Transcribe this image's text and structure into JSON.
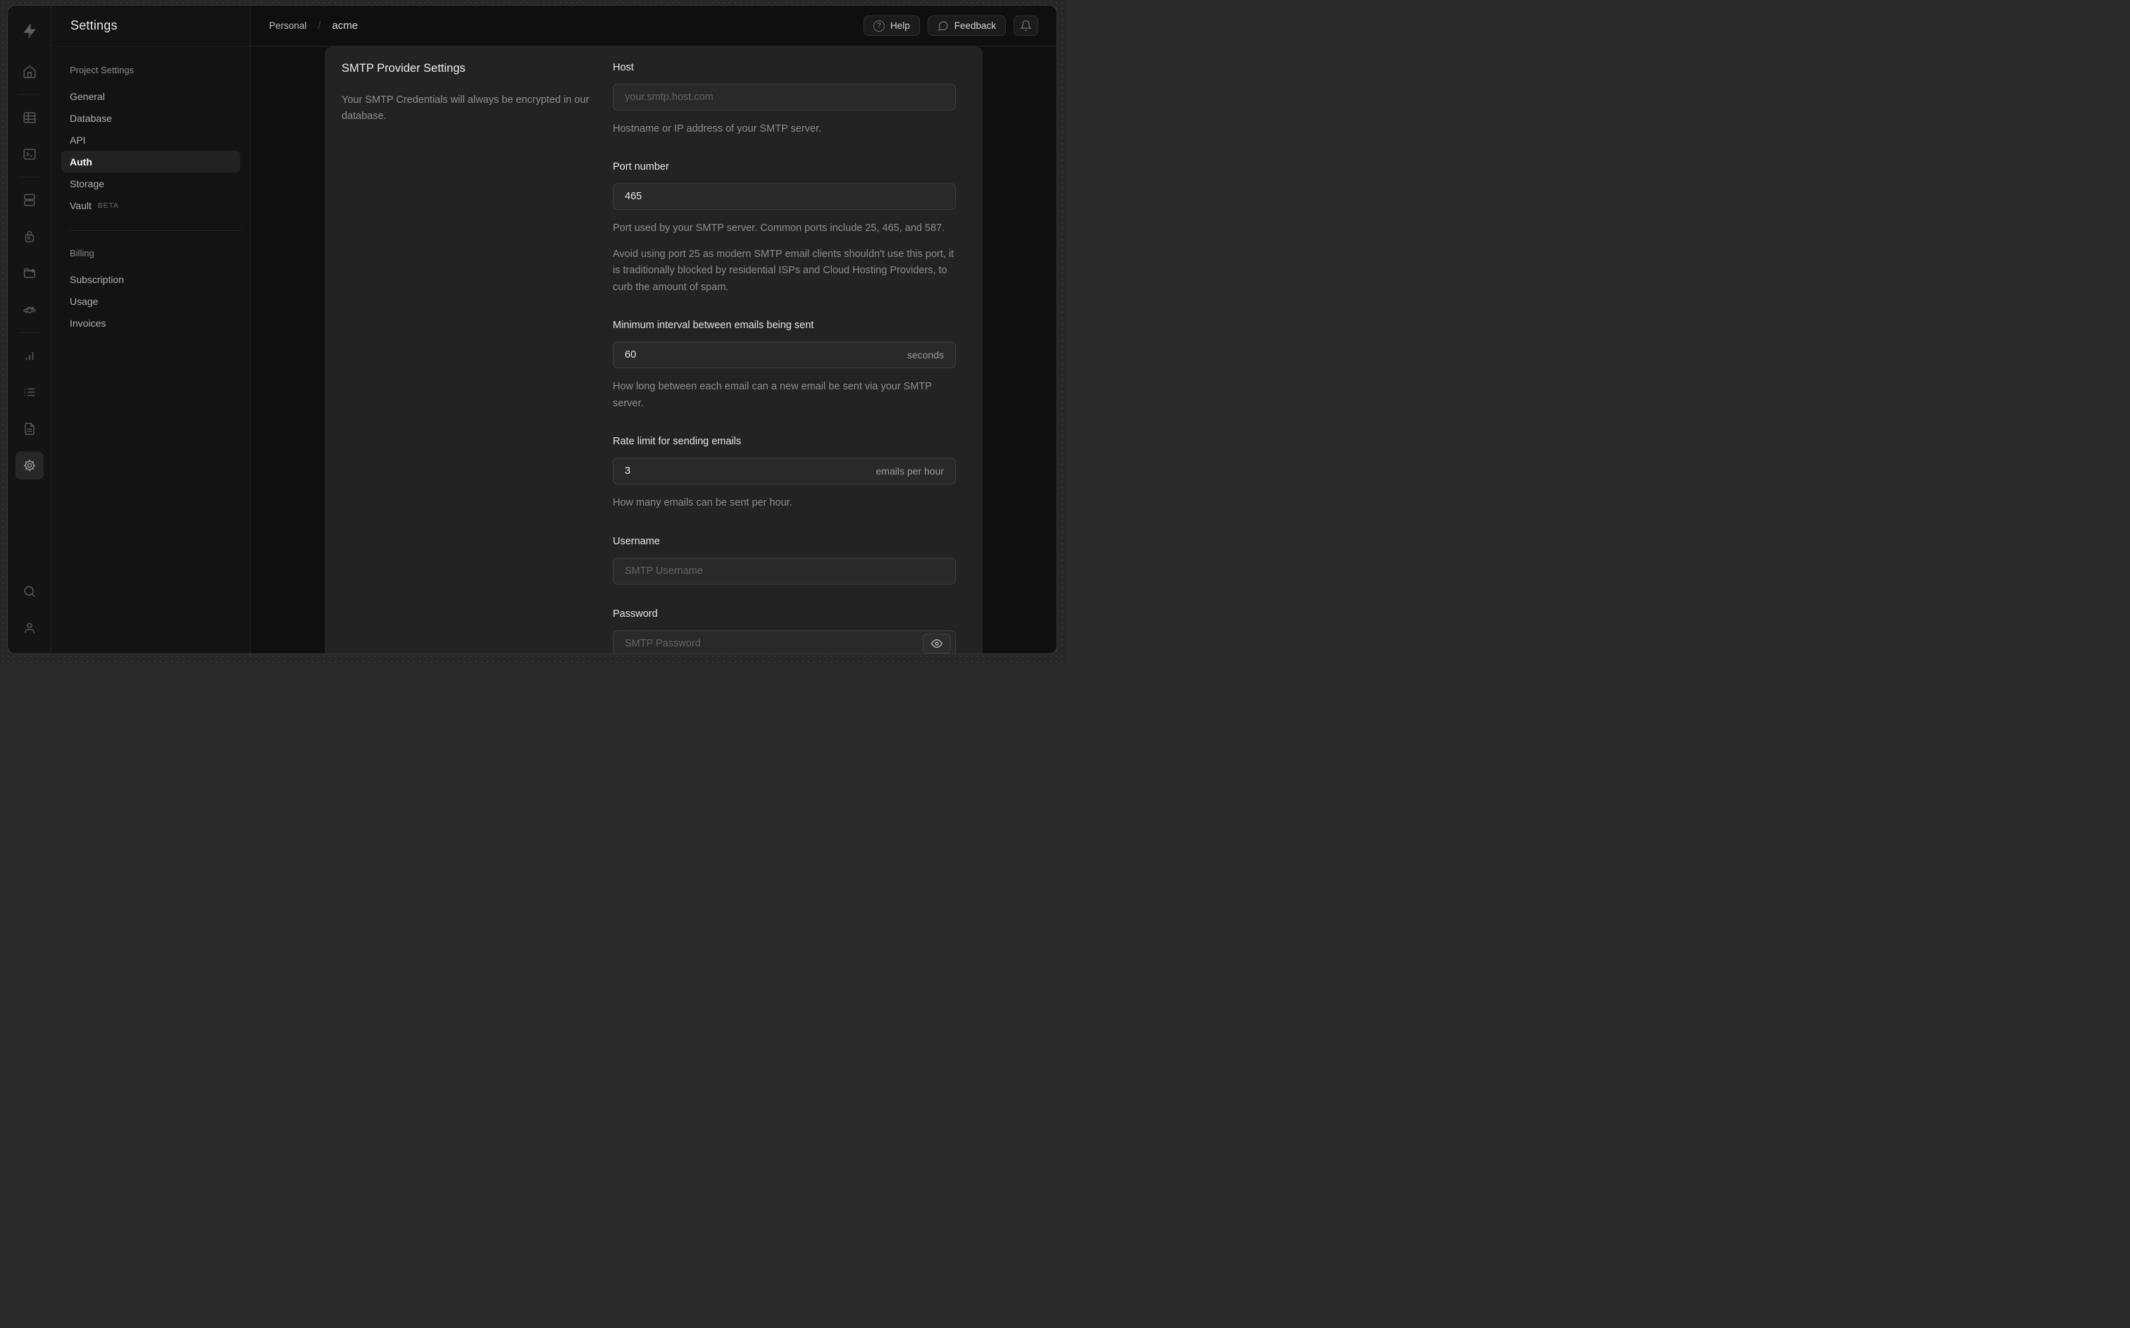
{
  "sidebar": {
    "title": "Settings",
    "sections": [
      {
        "header": "Project Settings",
        "items": [
          {
            "label": "General"
          },
          {
            "label": "Database"
          },
          {
            "label": "API"
          },
          {
            "label": "Auth",
            "active": true
          },
          {
            "label": "Storage"
          },
          {
            "label": "Vault",
            "badge": "BETA"
          }
        ]
      },
      {
        "header": "Billing",
        "items": [
          {
            "label": "Subscription"
          },
          {
            "label": "Usage"
          },
          {
            "label": "Invoices"
          }
        ]
      }
    ]
  },
  "topbar": {
    "breadcrumb_org": "Personal",
    "breadcrumb_separator": "/",
    "breadcrumb_project": "acme",
    "help_label": "Help",
    "help_icon_glyph": "?",
    "feedback_label": "Feedback"
  },
  "panel": {
    "title": "SMTP Provider Settings",
    "description": "Your SMTP Credentials will always be encrypted in our database.",
    "fields": [
      {
        "label": "Host",
        "placeholder": "your.smtp.host.com",
        "help": [
          "Hostname or IP address of your SMTP server."
        ]
      },
      {
        "label": "Port number",
        "value": "465",
        "help": [
          "Port used by your SMTP server. Common ports include 25, 465, and 587.",
          "Avoid using port 25 as modern SMTP email clients shouldn't use this port, it is traditionally blocked by residential ISPs and Cloud Hosting Providers, to curb the amount of spam."
        ]
      },
      {
        "label": "Minimum interval between emails being sent",
        "value": "60",
        "suffix": "seconds",
        "help": [
          "How long between each email can a new email be sent via your SMTP server."
        ]
      },
      {
        "label": "Rate limit for sending emails",
        "value": "3",
        "suffix": "emails per hour",
        "help": [
          "How many emails can be sent per hour."
        ]
      },
      {
        "label": "Username",
        "placeholder": "SMTP Username"
      },
      {
        "label": "Password",
        "placeholder": "SMTP Password"
      }
    ]
  },
  "colors": {
    "window_bg": "#0f0f0f",
    "panel_bg": "#232323",
    "sidebar_bg": "#131313",
    "input_bg": "#292929",
    "input_border": "#3d3d3d",
    "text_primary": "#ededed",
    "text_secondary": "#8d8d8d"
  }
}
